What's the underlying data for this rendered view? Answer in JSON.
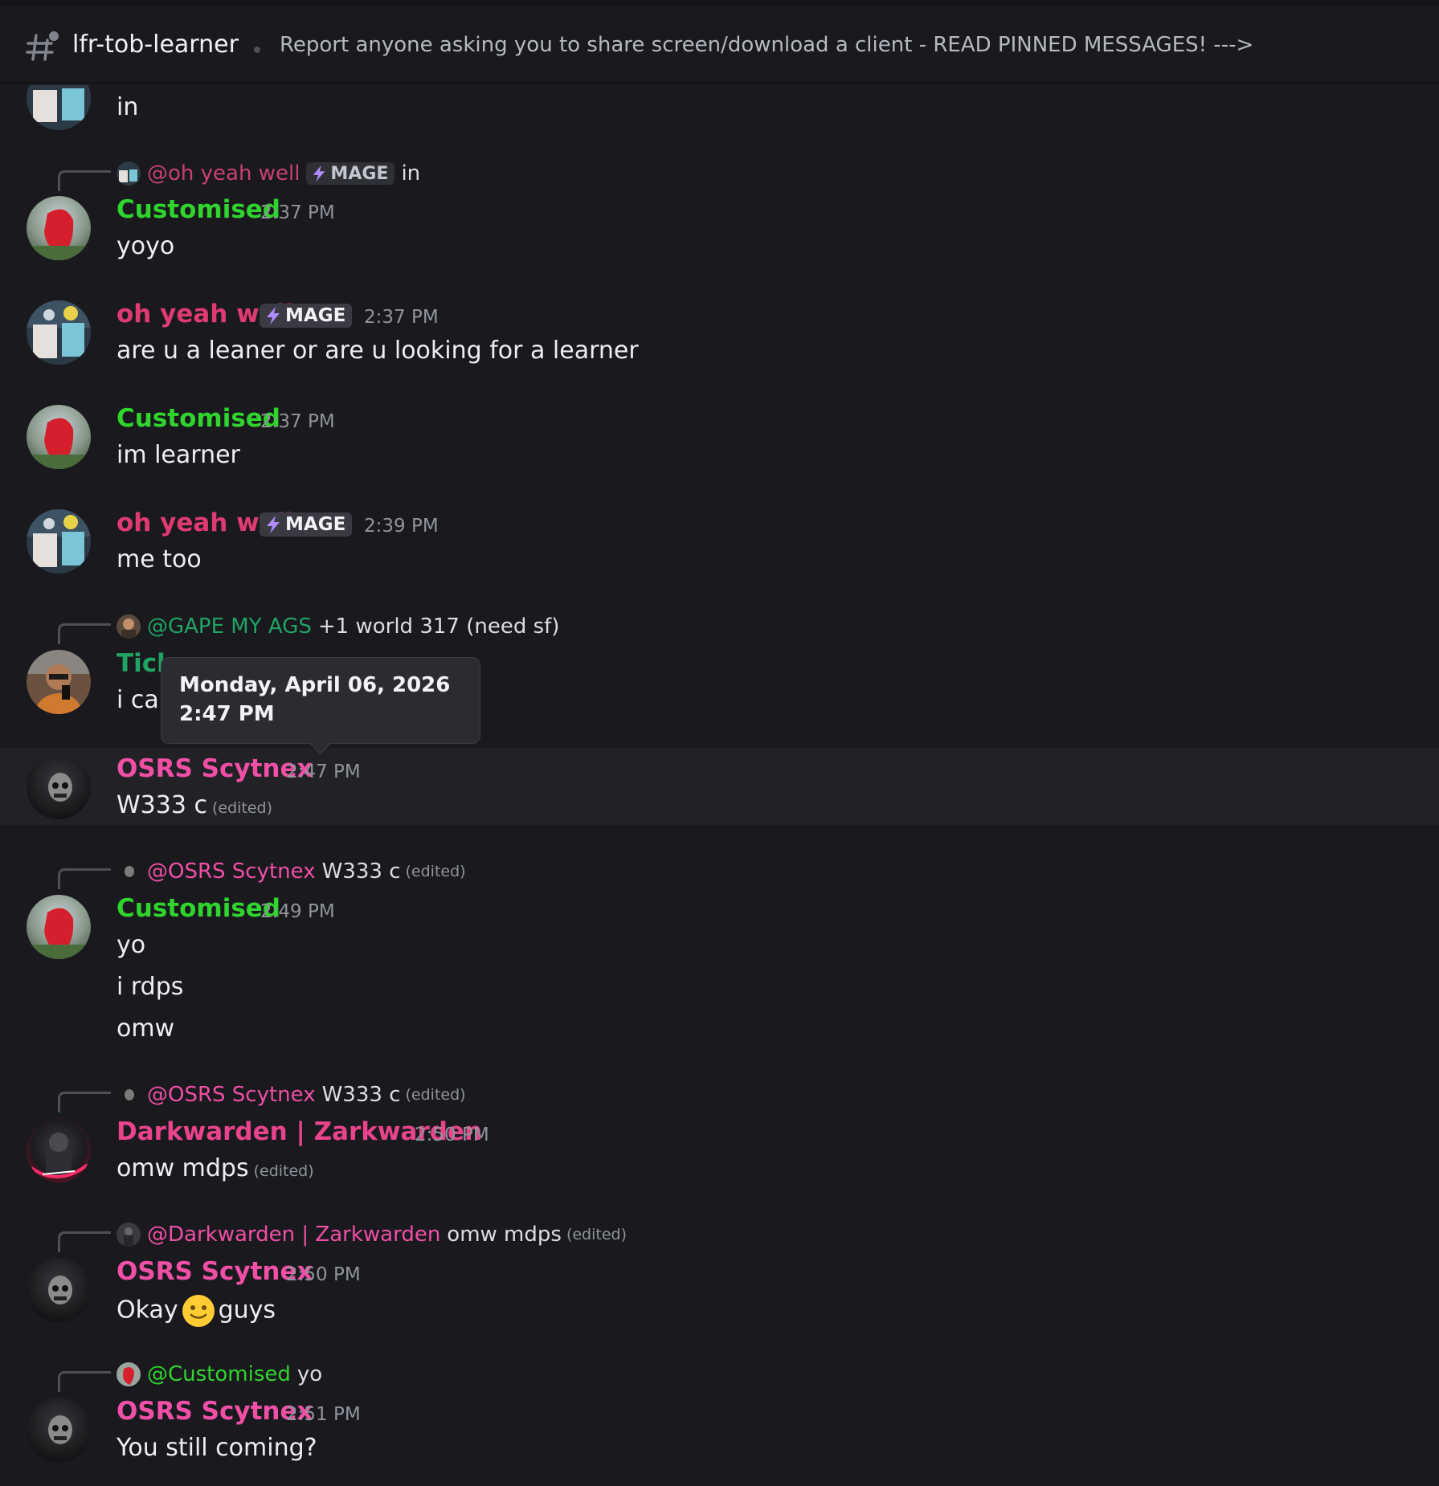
{
  "channel": {
    "name": "lfr-tob-learner",
    "topic": "Report anyone asking you to share screen/download a client - READ PINNED MESSAGES! --->"
  },
  "colors": {
    "background": "#1a1a1e",
    "customised": "#2fd42d",
    "oh_yeah_well": "#e03a72",
    "osrs_scytnex": "#f04fa6",
    "darkwarden": "#e8438b",
    "gape_my_ags": "#1fa463"
  },
  "tooltip": {
    "text": "Monday, April 06, 2026 2:47 PM"
  },
  "messages": [
    {
      "id": "m0",
      "text": "in"
    },
    {
      "id": "m1",
      "reply": {
        "name": "@oh yeah well",
        "badge": "MAGE",
        "text": "in"
      },
      "author": "Customised",
      "time": "2:37 PM",
      "lines": [
        "yoyo"
      ]
    },
    {
      "id": "m2",
      "author": "oh yeah well",
      "badge": "MAGE",
      "time": "2:37 PM",
      "lines": [
        "are u a leaner or are u looking for a learner"
      ]
    },
    {
      "id": "m3",
      "author": "Customised",
      "time": "2:37 PM",
      "lines": [
        "im learner"
      ]
    },
    {
      "id": "m4",
      "author": "oh yeah well",
      "badge": "MAGE",
      "time": "2:39 PM",
      "lines": [
        "me too"
      ]
    },
    {
      "id": "m5",
      "reply": {
        "name": "@GAPE MY AGS",
        "text": "+1 world 317 (need sf)"
      },
      "author": "Tick",
      "lines": [
        "i  ca"
      ]
    },
    {
      "id": "m6",
      "author": "OSRS Scytnex",
      "time": "2:47 PM",
      "lines": [
        "W333 c"
      ],
      "edited": "(edited)"
    },
    {
      "id": "m7",
      "reply": {
        "name": "@OSRS Scytnex",
        "text": "W333 c",
        "edited": "(edited)"
      },
      "author": "Customised",
      "time": "2:49 PM",
      "lines": [
        "yo",
        "i rdps",
        "omw"
      ]
    },
    {
      "id": "m8",
      "reply": {
        "name": "@OSRS Scytnex",
        "text": "W333 c",
        "edited": "(edited)"
      },
      "author": "Darkwarden | Zarkwarden",
      "time": "2:50 PM",
      "lines": [
        "omw mdps"
      ],
      "edited": "(edited)"
    },
    {
      "id": "m9",
      "reply": {
        "name": "@Darkwarden | Zarkwarden",
        "text": "omw mdps",
        "edited": "(edited)"
      },
      "author": "OSRS Scytnex",
      "time": "2:50 PM",
      "text_before": "Okay",
      "emoji": "slightly-smiling-face",
      "text_after": "guys"
    },
    {
      "id": "m10",
      "reply": {
        "name": "@Customised",
        "text": "yo"
      },
      "author": "OSRS Scytnex",
      "time": "2:51 PM",
      "lines": [
        "You still coming?"
      ]
    }
  ]
}
